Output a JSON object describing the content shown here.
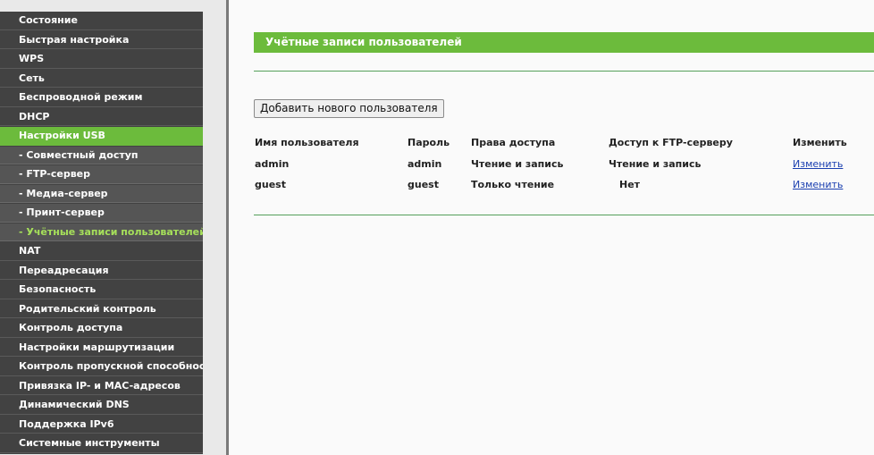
{
  "sidebar": {
    "items": [
      {
        "label": "Состояние"
      },
      {
        "label": "Быстрая настройка"
      },
      {
        "label": "WPS"
      },
      {
        "label": "Сеть"
      },
      {
        "label": "Беспроводной режим"
      },
      {
        "label": "DHCP"
      },
      {
        "label": "Настройки USB"
      },
      {
        "label": "- Совместный доступ"
      },
      {
        "label": "- FTP-сервер"
      },
      {
        "label": "- Медиа-сервер"
      },
      {
        "label": "- Принт-сервер"
      },
      {
        "label": "- Учётные записи пользователей"
      },
      {
        "label": "NAT"
      },
      {
        "label": "Переадресация"
      },
      {
        "label": "Безопасность"
      },
      {
        "label": "Родительский контроль"
      },
      {
        "label": "Контроль доступа"
      },
      {
        "label": "Настройки маршрутизации"
      },
      {
        "label": "Контроль пропускной способности"
      },
      {
        "label": "Привязка IP- и MAC-адресов"
      },
      {
        "label": "Динамический DNS"
      },
      {
        "label": "Поддержка IPv6"
      },
      {
        "label": "Системные инструменты"
      }
    ]
  },
  "main": {
    "title": "Учётные записи пользователей",
    "add_button_label": "Добавить нового пользователя",
    "table": {
      "headers": {
        "user": "Имя пользователя",
        "password": "Пароль",
        "rights": "Права доступа",
        "ftp": "Доступ к FTP-серверу",
        "edit": "Изменить"
      },
      "rows": [
        {
          "user": "admin",
          "password": "admin",
          "rights": "Чтение и запись",
          "ftp": "Чтение и запись",
          "edit": "Изменить"
        },
        {
          "user": "guest",
          "password": "guest",
          "rights": "Только чтение",
          "ftp": "Нет",
          "edit": "Изменить"
        }
      ]
    }
  },
  "colors": {
    "accent_green": "#6cbb3c",
    "sidebar_dark": "#424242",
    "link_blue": "#1a3fb0"
  }
}
